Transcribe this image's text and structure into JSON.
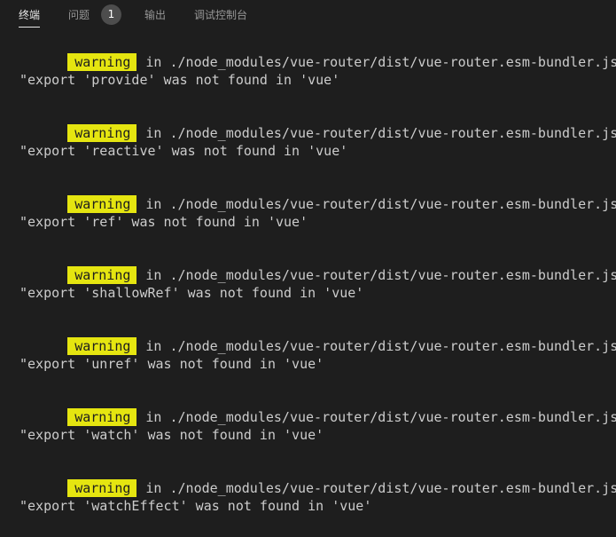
{
  "tabs": [
    {
      "label": "终端",
      "active": true
    },
    {
      "label": "问题",
      "active": false
    },
    {
      "label": "输出",
      "active": false
    },
    {
      "label": "调试控制台",
      "active": false
    }
  ],
  "problems_count": "1",
  "terminal": {
    "entries": [
      {
        "level": "warning",
        "location": "in ./node_modules/vue-router/dist/vue-router.esm-bundler.js",
        "message": "\"export 'provide' was not found in 'vue'"
      },
      {
        "level": "warning",
        "location": "in ./node_modules/vue-router/dist/vue-router.esm-bundler.js",
        "message": "\"export 'reactive' was not found in 'vue'"
      },
      {
        "level": "warning",
        "location": "in ./node_modules/vue-router/dist/vue-router.esm-bundler.js",
        "message": "\"export 'ref' was not found in 'vue'"
      },
      {
        "level": "warning",
        "location": "in ./node_modules/vue-router/dist/vue-router.esm-bundler.js",
        "message": "\"export 'shallowRef' was not found in 'vue'"
      },
      {
        "level": "warning",
        "location": "in ./node_modules/vue-router/dist/vue-router.esm-bundler.js",
        "message": "\"export 'unref' was not found in 'vue'"
      },
      {
        "level": "warning",
        "location": "in ./node_modules/vue-router/dist/vue-router.esm-bundler.js",
        "message": "\"export 'watch' was not found in 'vue'"
      },
      {
        "level": "warning",
        "location": "in ./node_modules/vue-router/dist/vue-router.esm-bundler.js",
        "message": "\"export 'watchEffect' was not found in 'vue'"
      }
    ]
  },
  "colors": {
    "background": "#1e1e1e",
    "warning_tag_bg": "#e5e510",
    "text": "#cccccc"
  }
}
